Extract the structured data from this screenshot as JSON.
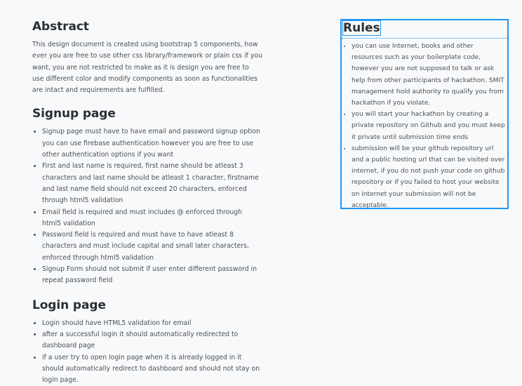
{
  "abstract": {
    "heading": "Abstract",
    "text": "This design document is created using bootstrap 5 components, how ever you are free to use other css library/framework or plain css if you want, you are not restricted to make as it is design you are free to use different color and modify components as soon as functionalities are intact and requirements are fulfilled."
  },
  "signup": {
    "heading": "Signup page",
    "items": [
      "Signup page must have to have email and password signup option you can use firebase authentication however you are free to use other authentication options if you want",
      "First and last name is required, first name should be atleast 3 characters and last name should be atleast 1 character, firstname and last name field should not exceed 20 characters, enforced through html5 validation",
      "Email field is required and must includes @ enforced through html5 validation",
      "Password field is required and must have to have atleast 8 characters and must include capital and small later characters, enforced through html5 validation",
      "Signup Form should not submit if user enter different password in repeat password field"
    ]
  },
  "login": {
    "heading": "Login page",
    "items": [
      "Login should have HTML5 validation for email",
      "after a successful login it should automatically redirected to dashboard page",
      "if a user try to open login page when it is already logged in it should automatically redirect to dashboard and should not stay on login page."
    ]
  },
  "rules": {
    "heading": "Rules",
    "items": [
      "you can use Internet, books and other resources such as your boilerplate code, however you are not supposed to talk or ask help from other participants of hackathon. SMIT management hold authority to qualify you from hackathon if you violate.",
      "you will start your hackathon by creating a private repository on Github and you must keep it private until submission time ends",
      "submission will be your github repository url and a public hosting url that can be visited over internet, if you do not push your code on github repository or if you failed to host your website on internet your submission will not be acceptable."
    ]
  },
  "colors": {
    "selection_outline": "#2196f3",
    "background": "#f8f9fa"
  }
}
